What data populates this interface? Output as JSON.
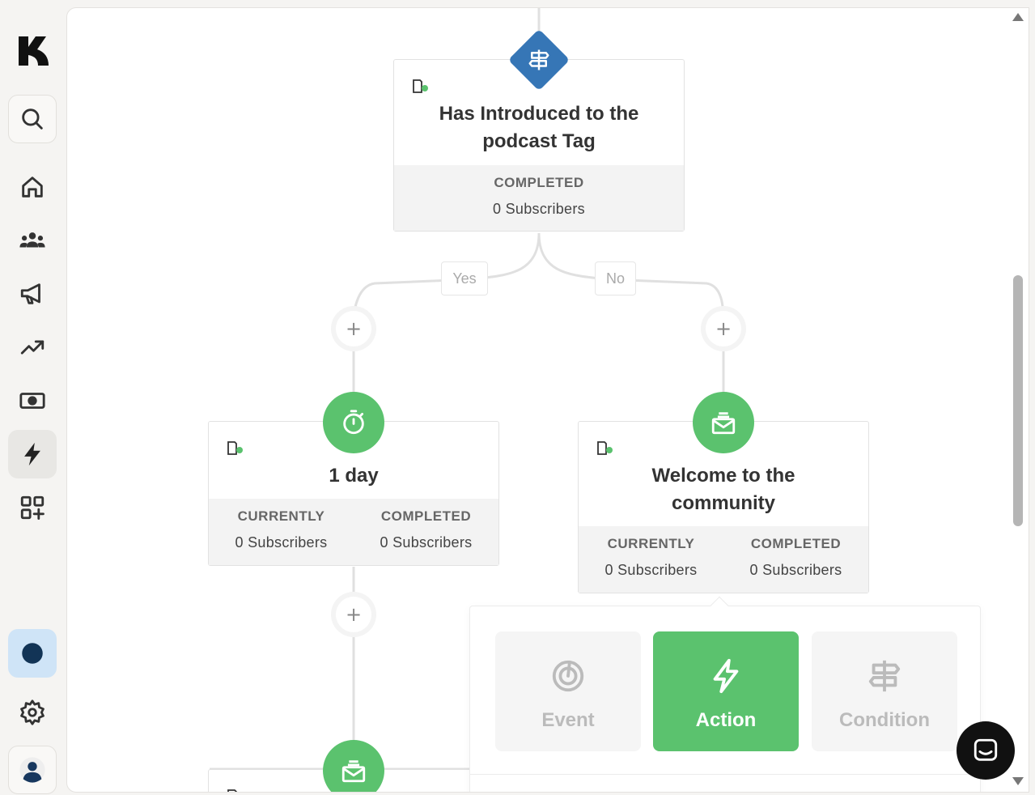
{
  "sidebar": {
    "logo": "K",
    "items": [
      {
        "icon": "search-icon"
      },
      {
        "icon": "home-icon"
      },
      {
        "icon": "subscribers-icon"
      },
      {
        "icon": "megaphone-icon"
      },
      {
        "icon": "growth-icon"
      },
      {
        "icon": "money-icon"
      },
      {
        "icon": "lightning-icon",
        "active": true
      },
      {
        "icon": "apps-icon"
      }
    ],
    "bottom": [
      {
        "icon": "profile-dot-icon"
      },
      {
        "icon": "gear-icon"
      },
      {
        "icon": "user-avatar-icon"
      }
    ]
  },
  "flow": {
    "condition_node": {
      "title": "Has Introduced to the podcast Tag",
      "stats": [
        {
          "label": "COMPLETED",
          "value": "0 Subscribers"
        }
      ]
    },
    "branches": {
      "yes": "Yes",
      "no": "No"
    },
    "plus_symbol": "+",
    "delay_node": {
      "title": "1 day",
      "stats": [
        {
          "label": "CURRENTLY",
          "value": "0 Subscribers"
        },
        {
          "label": "COMPLETED",
          "value": "0 Subscribers"
        }
      ]
    },
    "email_node": {
      "title": "Welcome to the community",
      "stats": [
        {
          "label": "CURRENTLY",
          "value": "0 Subscribers"
        },
        {
          "label": "COMPLETED",
          "value": "0 Subscribers"
        }
      ]
    }
  },
  "popover": {
    "options": [
      {
        "label": "Event",
        "icon": "event-target-icon",
        "selected": false
      },
      {
        "label": "Action",
        "icon": "lightning-icon",
        "selected": true
      },
      {
        "label": "Condition",
        "icon": "signpost-icon",
        "selected": false
      }
    ]
  },
  "colors": {
    "accent_green": "#5bc26e",
    "condition_blue": "#3676b6",
    "status_dot": "#5bc26e"
  }
}
